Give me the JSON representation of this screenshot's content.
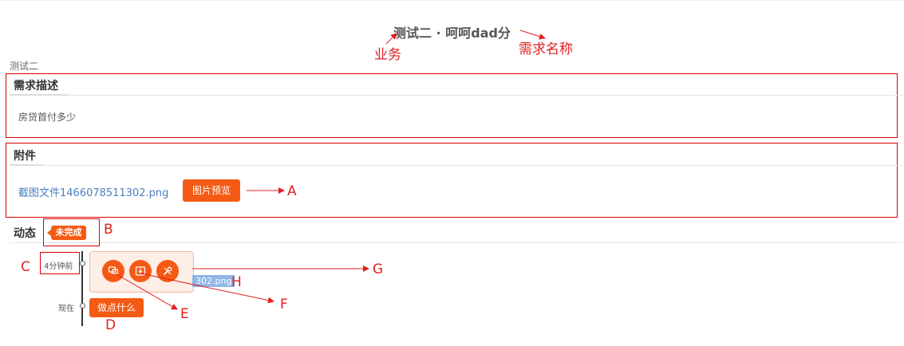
{
  "page": {
    "title": "测试二 · 呵呵dad分",
    "business_label": "测试二"
  },
  "description": {
    "heading": "需求描述",
    "text": "房贷首付多少"
  },
  "attachment": {
    "heading": "附件",
    "file_name": "截图文件1466078511302.png",
    "preview_button": "图片预览"
  },
  "activity": {
    "heading": "动态",
    "status_badge": "未完成",
    "timeline": [
      {
        "time": "4分钟前"
      },
      {
        "time": "现在"
      }
    ],
    "popover_file_chip": "302.png",
    "do_something_button": "做点什么",
    "popover_icons": [
      "comment-icon",
      "upload-icon",
      "tools-icon"
    ]
  },
  "annotations": {
    "business": "业务",
    "requirement_name": "需求名称",
    "A": "A",
    "B": "B",
    "C": "C",
    "D": "D",
    "E": "E",
    "F": "F",
    "G": "G",
    "H": "H"
  },
  "colors": {
    "accent": "#f55a14",
    "annotation": "#e02020",
    "link": "#4a7fbd",
    "highlight": "#8fb6e6"
  }
}
